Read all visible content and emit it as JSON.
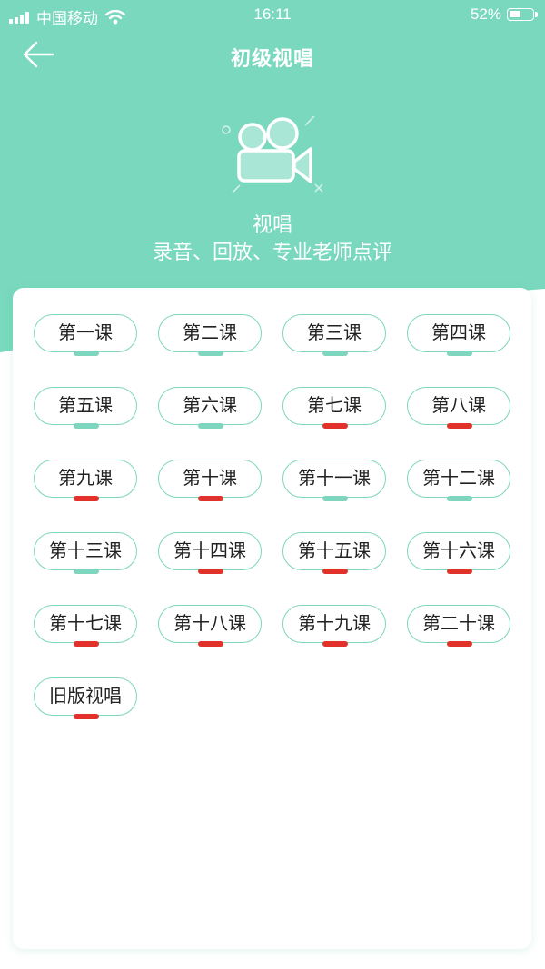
{
  "colors": {
    "accent": "#79d8bd",
    "done": "#7dd6bd",
    "pending": "#e0312b"
  },
  "status_bar": {
    "carrier": "中国移动",
    "time": "16:11",
    "battery": "52%",
    "battery_level": 0.52
  },
  "nav": {
    "title": "初级视唱",
    "back_icon": "arrow-left-icon"
  },
  "hero": {
    "icon": "video-camera-icon",
    "title": "视唱",
    "subtitle": "录音、回放、专业老师点评"
  },
  "lessons": [
    {
      "label": "第一课",
      "status": "done"
    },
    {
      "label": "第二课",
      "status": "done"
    },
    {
      "label": "第三课",
      "status": "done"
    },
    {
      "label": "第四课",
      "status": "done"
    },
    {
      "label": "第五课",
      "status": "done"
    },
    {
      "label": "第六课",
      "status": "done"
    },
    {
      "label": "第七课",
      "status": "pending"
    },
    {
      "label": "第八课",
      "status": "pending"
    },
    {
      "label": "第九课",
      "status": "pending"
    },
    {
      "label": "第十课",
      "status": "pending"
    },
    {
      "label": "第十一课",
      "status": "done"
    },
    {
      "label": "第十二课",
      "status": "done"
    },
    {
      "label": "第十三课",
      "status": "done"
    },
    {
      "label": "第十四课",
      "status": "pending"
    },
    {
      "label": "第十五课",
      "status": "pending"
    },
    {
      "label": "第十六课",
      "status": "pending"
    },
    {
      "label": "第十七课",
      "status": "pending"
    },
    {
      "label": "第十八课",
      "status": "pending"
    },
    {
      "label": "第十九课",
      "status": "pending"
    },
    {
      "label": "第二十课",
      "status": "pending"
    },
    {
      "label": "旧版视唱",
      "status": "pending"
    }
  ]
}
